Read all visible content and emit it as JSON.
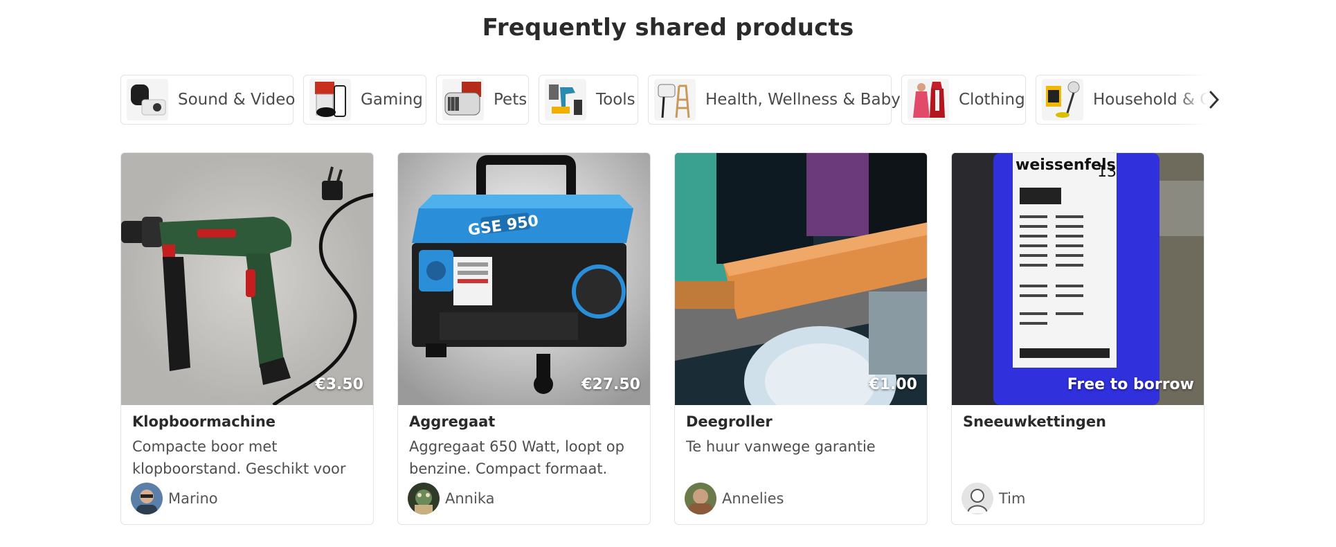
{
  "section_title": "Frequently shared products",
  "categories": [
    {
      "label": "Sound & Video",
      "icon": "speaker-projector-thumbnail"
    },
    {
      "label": "Gaming",
      "icon": "console-thumbnail"
    },
    {
      "label": "Pets",
      "icon": "pet-carrier-thumbnail"
    },
    {
      "label": "Tools",
      "icon": "tools-thumbnail"
    },
    {
      "label": "Health, Wellness & Baby",
      "icon": "baby-chair-thumbnail"
    },
    {
      "label": "Clothing",
      "icon": "costume-thumbnail"
    },
    {
      "label": "Household & Cl",
      "icon": "vacuum-thumbnail"
    }
  ],
  "products": [
    {
      "name": "Klopboormachine",
      "description": "Compacte boor met klopboorstand. Geschikt voor",
      "price": "€3.50",
      "owner": "Marino"
    },
    {
      "name": "Aggregaat",
      "description": "Aggregaat 650 Watt, loopt op benzine. Compact formaat.",
      "price": "€27.50",
      "owner": "Annika"
    },
    {
      "name": "Deegroller",
      "description": "Te huur vanwege garantie",
      "price": "€1.00",
      "owner": "Annelies"
    },
    {
      "name": "Sneeuwkettingen",
      "description": "",
      "price": "Free to borrow",
      "owner": "Tim"
    }
  ],
  "product_images": [
    "power-drill-photo",
    "generator-photo",
    "rolling-pin-photo",
    "snow-chains-photo"
  ],
  "generator_label": "GSE 950",
  "snowchain_brand": "weissenfels",
  "snowchain_number": "13",
  "colors": {
    "title": "#2b2b2b",
    "border": "#e4e4e4",
    "text_muted": "#4e4e4e"
  }
}
